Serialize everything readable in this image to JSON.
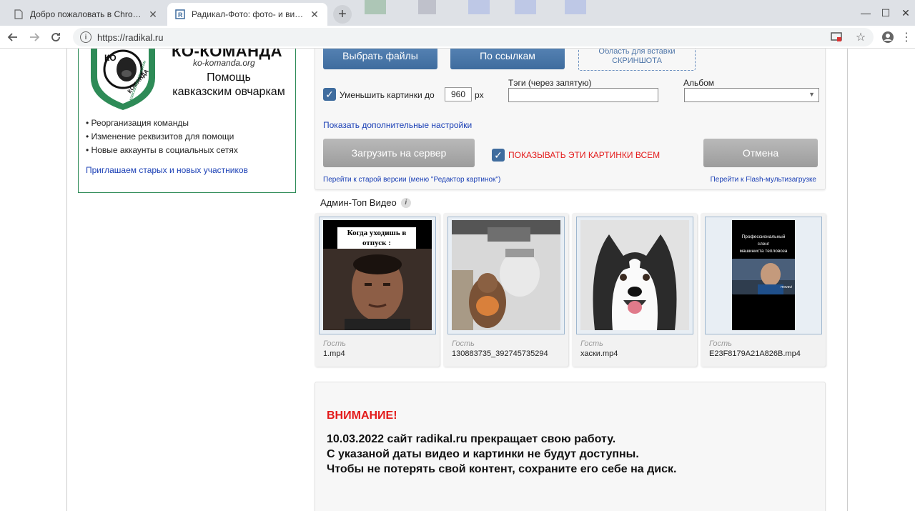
{
  "browser": {
    "tabs": [
      {
        "title": "Добро пожаловать в Chrome!",
        "active": false
      },
      {
        "title": "Радикал-Фото: фото- и видеохостинг",
        "active": true
      }
    ],
    "new_tab": "+",
    "window_controls": {
      "minimize": "—",
      "maximize": "☐",
      "close": "✕"
    },
    "url": "https://radikal.ru",
    "icons": {
      "back": "back-arrow-icon",
      "forward": "forward-arrow-icon",
      "reload": "reload-icon",
      "info": "info-icon",
      "cast": "cast-icon",
      "bookmark": "star-icon",
      "profile": "profile-icon",
      "menu": "kebab-menu-icon"
    }
  },
  "ad": {
    "title": "КО-КОМАНДА",
    "site": "ko-komanda.org",
    "help_line1": "Помощь",
    "help_line2": "кавказским овчаркам",
    "logo_text": {
      "top": "КО",
      "side": "КОМАНДА",
      "ring": "кавказским овчаркам"
    },
    "items": [
      "Реорганизация команды",
      "Изменение реквизитов для помощи",
      "Новые аккаунты в социальных сетях"
    ],
    "link": "Приглашаем старых и новых участников"
  },
  "upload": {
    "select_files": "Выбрать файлы",
    "by_links": "По ссылкам",
    "paste_line1": "Область для вставки",
    "paste_line2": "СКРИНШОТА",
    "reduce_label": "Уменьшить картинки до",
    "reduce_value": "960",
    "reduce_unit": "px",
    "reduce_checked": true,
    "tags_label": "Тэги (через запятую)",
    "tags_value": "",
    "album_label": "Альбом",
    "album_value": "",
    "more_settings": "Показать дополнительные настройки",
    "upload_button": "Загрузить на сервер",
    "show_all_label": "ПОКАЗЫВАТЬ ЭТИ КАРТИНКИ ВСЕМ",
    "show_all_checked": true,
    "cancel_button": "Отмена",
    "old_version_link": "Перейти к старой версии (меню \"Редактор картинок\")",
    "flash_link": "Перейти к Flash-мультизагрузке"
  },
  "videos": {
    "title": "Админ-Топ Видео",
    "info_glyph": "i",
    "items": [
      {
        "author": "Гость",
        "filename": "1.mp4",
        "caption_line1": "Когда уходишь в",
        "caption_line2": "отпуск :"
      },
      {
        "author": "Гость",
        "filename": "130883735_392745735294"
      },
      {
        "author": "Гость",
        "filename": "хаски.mp4"
      },
      {
        "author": "Гость",
        "filename": "E23F8179A21A826B.mp4",
        "caption_line1": "Профессиональный",
        "caption_line2": "сленг",
        "caption_line3": "машиниста тепловоза",
        "watermark": "movavi"
      }
    ]
  },
  "notice": {
    "title": "ВНИМАНИЕ!",
    "line1": "10.03.2022 сайт radikal.ru прекращает свою работу.",
    "line2": "С указаной даты видео и картинки не будут доступны.",
    "line3": "Чтобы не потерять свой контент, сохраните его себе на диск."
  },
  "colors": {
    "brand_blue": "#3f6c9e",
    "link_blue": "#1a3fb5",
    "warning_red": "#e31b1b",
    "ad_green": "#2e8b57"
  }
}
